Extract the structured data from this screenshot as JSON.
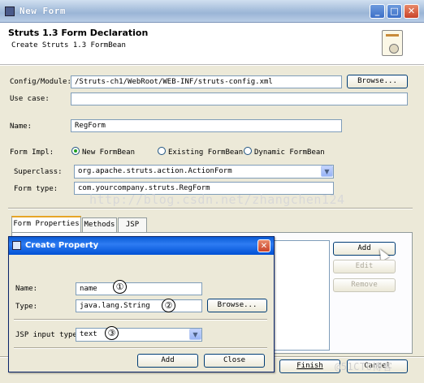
{
  "window": {
    "title": "New Form",
    "min_icon": "minimize-icon",
    "max_icon": "maximize-icon",
    "close_icon": "close-icon"
  },
  "header": {
    "title": "Struts 1.3 Form Declaration",
    "subtitle": "Create Struts 1.3 FormBean",
    "icon": "form-wizard-icon"
  },
  "form": {
    "config_label": "Config/Module:",
    "config_value": "/Struts-ch1/WebRoot/WEB-INF/struts-config.xml",
    "browse_label": "Browse...",
    "usecase_label": "Use case:",
    "usecase_value": "",
    "name_label": "Name:",
    "name_value": "RegForm",
    "impl_label": "Form Impl:",
    "impl_options": [
      "New FormBean",
      "Existing FormBean",
      "Dynamic FormBean"
    ],
    "superclass_label": "Superclass:",
    "superclass_value": "org.apache.struts.action.ActionForm",
    "formtype_label": "Form type:",
    "formtype_value": "com.yourcompany.struts.RegForm"
  },
  "watermark": "http://blog.csdn.net/zhangchen124",
  "tabs": [
    "Form Properties",
    "Methods",
    "JSP"
  ],
  "side_buttons": {
    "add": "Add",
    "edit": "Edit",
    "remove": "Remove"
  },
  "footer": {
    "finish": "Finish",
    "cancel": "Cancel",
    "corner_watermark": "@51CTO博客"
  },
  "dialog": {
    "title": "Create Property",
    "name_label": "Name:",
    "name_value": "name",
    "type_label": "Type:",
    "type_value": "java.lang.String",
    "browse_label": "Browse...",
    "jsp_label": "JSP input type",
    "jsp_value": "text",
    "add_label": "Add",
    "close_label": "Close",
    "markers": [
      "①",
      "②",
      "③"
    ]
  }
}
